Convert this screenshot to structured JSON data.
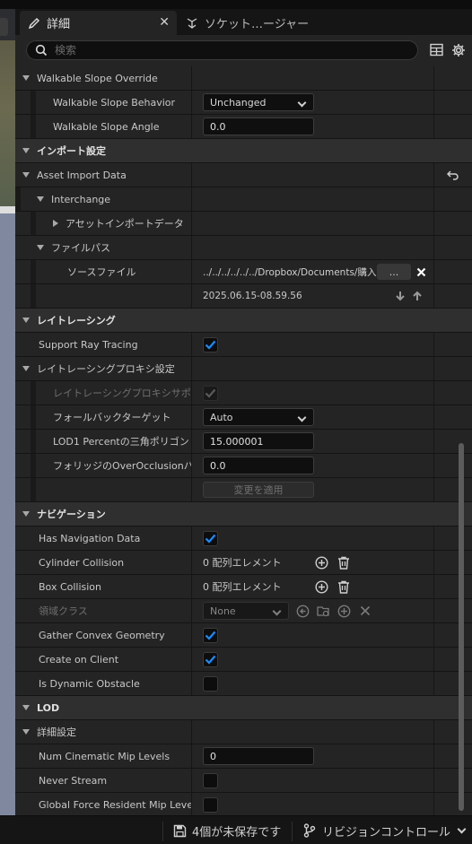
{
  "tabs": [
    {
      "label": "詳細",
      "close": "✕"
    },
    {
      "label": "ソケット…ージャー"
    }
  ],
  "search": {
    "placeholder": "検索"
  },
  "sections": {
    "walkable_slope_override": "Walkable Slope Override",
    "import_settings": "インポート設定",
    "ray_tracing": "レイトレーシング",
    "navigation": "ナビゲーション",
    "lod": "LOD"
  },
  "walkable": {
    "behavior_label": "Walkable Slope Behavior",
    "behavior_value": "Unchanged",
    "angle_label": "Walkable Slope Angle",
    "angle_value": "0.0"
  },
  "asset_import": {
    "label": "Asset Import Data",
    "interchange": "Interchange",
    "asset_import_data": "アセットインポートデータ",
    "file_path": "ファイルパス",
    "source_file_label": "ソースファイル",
    "source_file_value": "../../../../../../Dropbox/Documents/購入",
    "browse": "...",
    "timestamp": "2025.06.15-08.59.56"
  },
  "ray_tracing": {
    "support_label": "Support Ray Tracing",
    "support_checked": true,
    "proxy_settings": "レイトレーシングプロキシ設定",
    "proxy_support": "レイトレーシングプロキシサポート",
    "fallback_label": "フォールバックターゲット",
    "fallback_value": "Auto",
    "lod1_label": "LOD1 Percentの三角ポリゴン",
    "lod1_value": "15.000001",
    "foliage_label": "フォリッジのOverOcclusionバイアス",
    "foliage_value": "0.0",
    "apply": "変更を適用"
  },
  "navigation": {
    "has_nav_label": "Has Navigation Data",
    "cylinder_label": "Cylinder Collision",
    "cylinder_value": "0 配列エレメント",
    "box_label": "Box Collision",
    "box_value": "0 配列エレメント",
    "area_class_label": "領域クラス",
    "area_class_value": "None",
    "gather_label": "Gather Convex Geometry",
    "create_label": "Create on Client",
    "dynamic_label": "Is Dynamic Obstacle"
  },
  "lod": {
    "detail_settings": "詳細設定",
    "num_cinematic_label": "Num Cinematic Mip Levels",
    "num_cinematic_value": "0",
    "never_stream_label": "Never Stream",
    "global_force_label": "Global Force Resident Mip Levels"
  },
  "statusbar": {
    "unsaved": "4個が未保存です",
    "revision": "リビジョンコントロール"
  },
  "colors": {
    "accent": "#1a8cff",
    "panel": "#242424",
    "category": "#2f2f2f"
  }
}
